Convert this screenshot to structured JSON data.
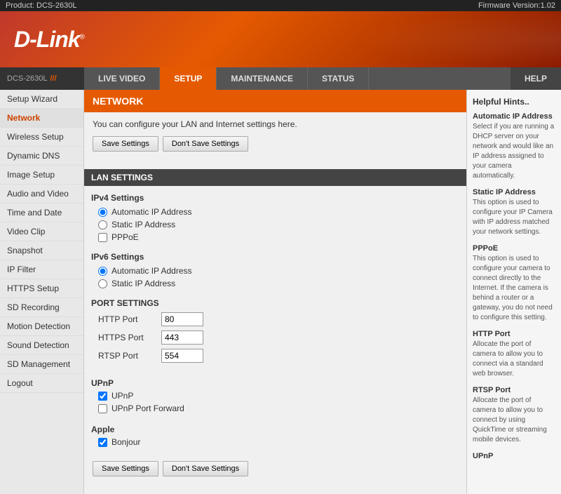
{
  "topbar": {
    "product": "Product: DCS-2630L",
    "firmware": "Firmware Version:1.02"
  },
  "logo": {
    "text": "D-Link",
    "trademark": "®"
  },
  "nav": {
    "brand": "DCS-2630L",
    "brand_slashes": "///",
    "tabs": [
      {
        "id": "live-video",
        "label": "LIVE VIDEO",
        "active": false
      },
      {
        "id": "setup",
        "label": "SETUP",
        "active": true
      },
      {
        "id": "maintenance",
        "label": "MAINTENANCE",
        "active": false
      },
      {
        "id": "status",
        "label": "STATUS",
        "active": false
      }
    ],
    "help": "HELP"
  },
  "sidebar": {
    "items": [
      {
        "id": "setup-wizard",
        "label": "Setup Wizard",
        "active": false
      },
      {
        "id": "network",
        "label": "Network",
        "active": true
      },
      {
        "id": "wireless-setup",
        "label": "Wireless Setup",
        "active": false
      },
      {
        "id": "dynamic-dns",
        "label": "Dynamic DNS",
        "active": false
      },
      {
        "id": "image-setup",
        "label": "Image Setup",
        "active": false
      },
      {
        "id": "audio-and-video",
        "label": "Audio and Video",
        "active": false
      },
      {
        "id": "time-and-date",
        "label": "Time and Date",
        "active": false
      },
      {
        "id": "video-clip",
        "label": "Video Clip",
        "active": false
      },
      {
        "id": "snapshot",
        "label": "Snapshot",
        "active": false
      },
      {
        "id": "ip-filter",
        "label": "IP Filter",
        "active": false
      },
      {
        "id": "https-setup",
        "label": "HTTPS Setup",
        "active": false
      },
      {
        "id": "sd-recording",
        "label": "SD Recording",
        "active": false
      },
      {
        "id": "motion-detection",
        "label": "Motion Detection",
        "active": false
      },
      {
        "id": "sound-detection",
        "label": "Sound Detection",
        "active": false
      },
      {
        "id": "sd-management",
        "label": "SD Management",
        "active": false
      },
      {
        "id": "logout",
        "label": "Logout",
        "active": false
      }
    ]
  },
  "content": {
    "section_title": "NETWORK",
    "description": "You can configure your LAN and Internet settings here.",
    "save_button": "Save Settings",
    "dont_save_button": "Don't Save Settings",
    "lan_settings_title": "LAN SETTINGS",
    "ipv4_label": "IPv4 Settings",
    "ipv4_options": [
      {
        "id": "auto-ip",
        "label": "Automatic IP Address",
        "checked": true
      },
      {
        "id": "static-ip",
        "label": "Static IP Address",
        "checked": false
      },
      {
        "id": "pppoe",
        "label": "PPPoE",
        "checked": false
      }
    ],
    "ipv6_label": "IPv6 Settings",
    "ipv6_options": [
      {
        "id": "ipv6-auto-ip",
        "label": "Automatic IP Address",
        "checked": true
      },
      {
        "id": "ipv6-static-ip",
        "label": "Static IP Address",
        "checked": false
      }
    ],
    "port_settings_title": "PORT SETTINGS",
    "ports": [
      {
        "id": "http-port",
        "label": "HTTP Port",
        "value": "80"
      },
      {
        "id": "https-port",
        "label": "HTTPS Port",
        "value": "443"
      },
      {
        "id": "rtsp-port",
        "label": "RTSP Port",
        "value": "554"
      }
    ],
    "upnp_title": "UPnP",
    "upnp_options": [
      {
        "id": "upnp",
        "label": "UPnP",
        "checked": true
      },
      {
        "id": "upnp-port-forward",
        "label": "UPnP Port Forward",
        "checked": false
      }
    ],
    "apple_title": "Apple",
    "apple_options": [
      {
        "id": "bonjour",
        "label": "Bonjour",
        "checked": true
      }
    ]
  },
  "help": {
    "title": "Helpful Hints..",
    "entries": [
      {
        "title": "Automatic IP Address",
        "text": "Select if you are running a DHCP server on your network and would like an IP address assigned to your camera automatically."
      },
      {
        "title": "Static IP Address",
        "text": "This option is used to configure your IP Camera with IP address matched your network settings."
      },
      {
        "title": "PPPoE",
        "text": "This option is used to configure your camera to connect directly to the Internet. If the camera is behind a router or a gateway, you do not need to configure this setting."
      },
      {
        "title": "HTTP Port",
        "text": "Allocate the port of camera to allow you to connect via a standard web browser."
      },
      {
        "title": "RTSP Port",
        "text": "Allocate the port of camera to allow you to connect by using QuickTime or streaming mobile devices."
      },
      {
        "title": "UPnP",
        "text": ""
      }
    ]
  }
}
